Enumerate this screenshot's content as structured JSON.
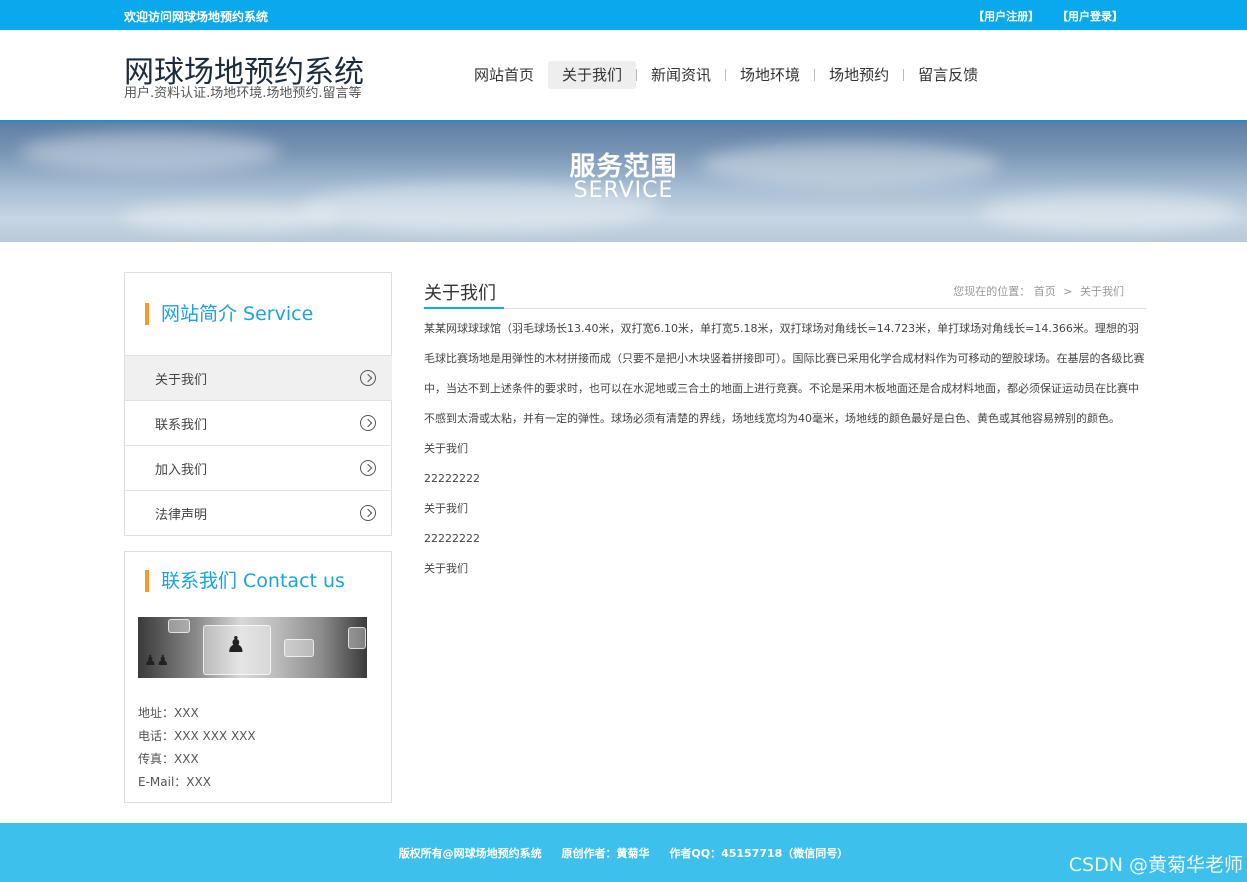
{
  "topbar": {
    "welcome": "欢迎访问网球场地预约系统",
    "register": "【用户注册】",
    "login": "【用户登录】"
  },
  "header": {
    "site_title": "网球场地预约系统",
    "site_subtitle": "用户.资料认证.场地环境.场地预约.留言等",
    "nav": [
      "网站首页",
      "关于我们",
      "新闻资讯",
      "场地环境",
      "场地预约",
      "留言反馈"
    ],
    "nav_active": "关于我们"
  },
  "banner": {
    "title_cn": "服务范围",
    "title_en": "SERVICE"
  },
  "sidebar": {
    "intro_title": "网站简介 Service",
    "menu": [
      "关于我们",
      "联系我们",
      "加入我们",
      "法律声明"
    ],
    "contact_title": "联系我们 Contact us",
    "contact_lines": [
      "地址：XXX",
      "电话：XXX XXX XXX",
      "传真：XXX",
      "E-Mail：XXX"
    ]
  },
  "main": {
    "title": "关于我们",
    "breadcrumb_prefix": "您现在的位置：",
    "breadcrumb_home": "首页",
    "breadcrumb_sep": ">",
    "breadcrumb_current": "关于我们",
    "paragraph": "某某网球球球馆（羽毛球场长13.40米，双打宽6.10米，单打宽5.18米，双打球场对角线长=14.723米，单打球场对角线长=14.366米。理想的羽毛球比赛场地是用弹性的木材拼接而成（只要不是把小木块竖着拼接即可）。国际比赛已采用化学合成材料作为可移动的塑胶球场。在基层的各级比赛中，当达不到上述条件的要求时，也可以在水泥地或三合土的地面上进行竞赛。不论是采用木板地面还是合成材料地面，都必须保证运动员在比赛中不感到太滑或太粘，并有一定的弹性。球场必须有清楚的界线，场地线宽均为40毫米，场地线的颜色最好是白色、黄色或其他容易辨别的颜色。",
    "lines": [
      "关于我们",
      "22222222",
      "关于我们",
      "22222222",
      "关于我们"
    ]
  },
  "footer": {
    "copyright": "版权所有@网球场地预约系统",
    "author": "原创作者：黄菊华",
    "qq": "作者QQ：45157718（微信同号）",
    "watermark": "CSDN @黄菊华老师"
  },
  "colors": {
    "topbar": "#0aa8ec",
    "footer": "#3ec0ec",
    "accent_orange": "#f39c28",
    "heading_blue": "#1aa3df"
  }
}
